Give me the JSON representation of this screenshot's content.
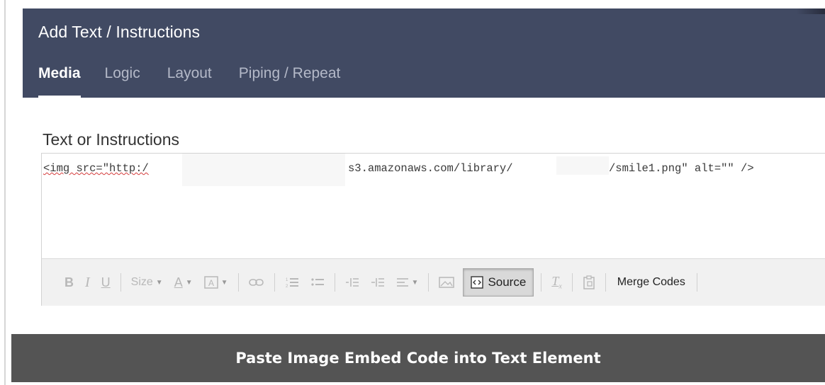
{
  "dialog": {
    "title": "Add Text / Instructions",
    "tabs": [
      {
        "label": "Media",
        "active": true
      },
      {
        "label": "Logic",
        "active": false
      },
      {
        "label": "Layout",
        "active": false
      },
      {
        "label": "Piping / Repeat",
        "active": false
      }
    ]
  },
  "editor": {
    "label": "Text or Instructions",
    "code": {
      "part1": "<img src=\"http:/",
      "part2": "s3.amazonaws.com/library/",
      "part3": "/smile1.png\" alt=\"\" />"
    },
    "toolbar": {
      "size_label": "Size",
      "source_label": "Source",
      "merge_label": "Merge Codes"
    }
  },
  "caption": {
    "text": "Paste Image Embed Code into Text Element"
  },
  "colors": {
    "header_bg": "#414a63",
    "caption_bg": "#545454",
    "toolbar_bg": "#f1f1f1"
  }
}
